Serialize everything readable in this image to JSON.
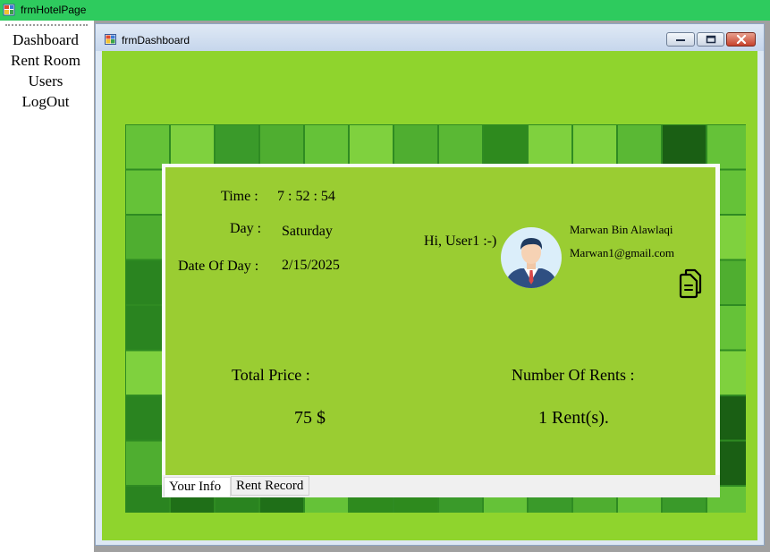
{
  "outer_window": {
    "title": "frmHotelPage"
  },
  "menu": {
    "items": [
      {
        "label": "Dashboard"
      },
      {
        "label": "Rent Room"
      },
      {
        "label": "Users"
      },
      {
        "label": "LogOut"
      }
    ]
  },
  "child_window": {
    "title": "frmDashboard"
  },
  "info": {
    "time_label": "Time :",
    "time_value": "7 : 52 : 54",
    "day_label": "Day :",
    "day_value": "Saturday",
    "date_label": "Date Of Day :",
    "date_value": "2/15/2025"
  },
  "user": {
    "greeting": "Hi, User1 :-)",
    "name": "Marwan Bin Alawlaqi",
    "email": "Marwan1@gmail.com"
  },
  "stats": {
    "total_price_label": "Total Price :",
    "total_price_value": "75 $",
    "rents_label": "Number Of Rents  :",
    "rents_value": "1 Rent(s)."
  },
  "tabs": [
    {
      "label": "Your Info",
      "selected": true
    },
    {
      "label": "Rent Record",
      "selected": false
    }
  ],
  "icons": {
    "app": "winforms-app-icon",
    "avatar": "businessman-avatar",
    "copy": "copy-document-icon"
  },
  "colors": {
    "outer_title": "#2ecb5e",
    "client_green": "#8fd42d",
    "panel_green": "#9acd32"
  }
}
